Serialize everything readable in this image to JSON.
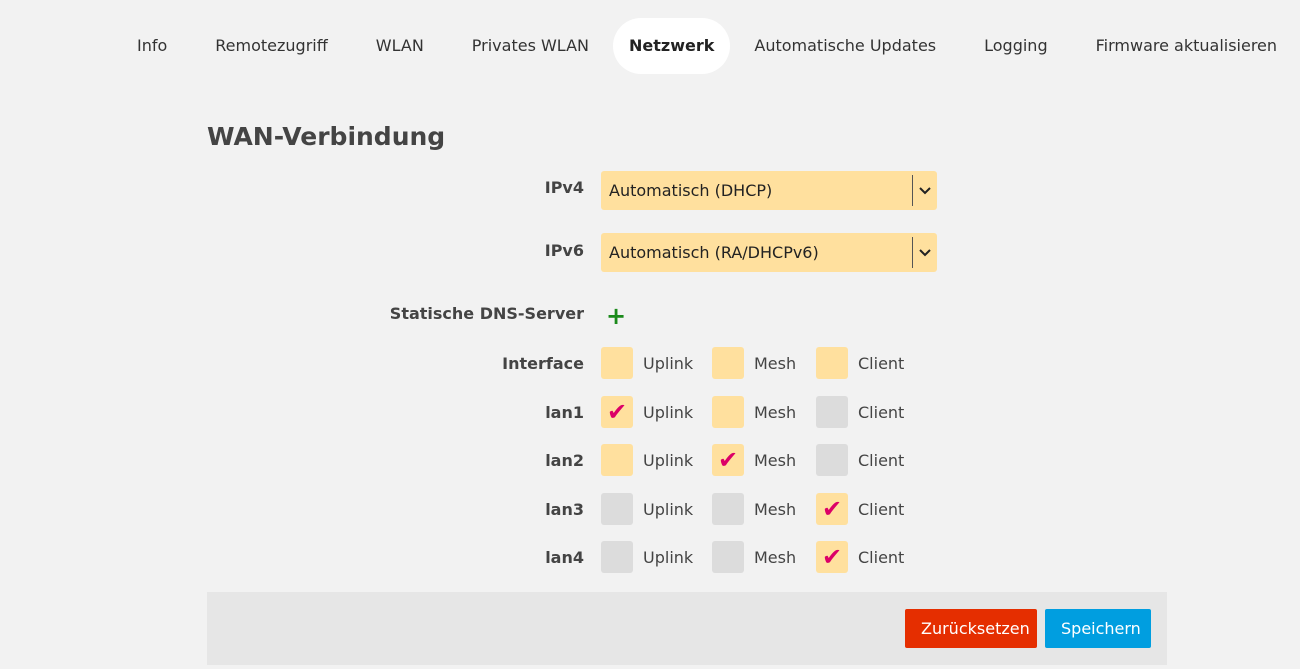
{
  "nav": {
    "tabs": [
      {
        "label": "Info"
      },
      {
        "label": "Remotezugriff"
      },
      {
        "label": "WLAN"
      },
      {
        "label": "Privates WLAN"
      },
      {
        "label": "Netzwerk",
        "active": true
      },
      {
        "label": "Automatische Updates"
      },
      {
        "label": "Logging"
      },
      {
        "label": "Firmware aktualisieren"
      }
    ]
  },
  "section": {
    "title": "WAN-Verbindung"
  },
  "ipv4": {
    "label": "IPv4",
    "value": "Automatisch (DHCP)"
  },
  "ipv6": {
    "label": "IPv6",
    "value": "Automatisch (RA/DHCPv6)"
  },
  "dns": {
    "label": "Statische DNS-Server",
    "add_icon": "+"
  },
  "interfaces": {
    "col_labels": [
      "Uplink",
      "Mesh",
      "Client"
    ],
    "check_glyph": "✔",
    "rows": [
      {
        "name": "Interface",
        "checks": [
          false,
          false,
          false
        ],
        "enabled": [
          true,
          true,
          true
        ]
      },
      {
        "name": "lan1",
        "checks": [
          true,
          false,
          false
        ],
        "enabled": [
          true,
          true,
          false
        ]
      },
      {
        "name": "lan2",
        "checks": [
          false,
          true,
          false
        ],
        "enabled": [
          true,
          true,
          false
        ]
      },
      {
        "name": "lan3",
        "checks": [
          false,
          false,
          true
        ],
        "enabled": [
          false,
          false,
          true
        ]
      },
      {
        "name": "lan4",
        "checks": [
          false,
          false,
          true
        ],
        "enabled": [
          false,
          false,
          true
        ]
      }
    ]
  },
  "buttons": {
    "reset": "Zurücksetzen",
    "save": "Speichern"
  },
  "colors": {
    "checkbox_on": "#ffe09e",
    "checkbox_off": "#dcdcdc",
    "check": "#dc0067",
    "reset": "#e52e00",
    "save": "#009ee0"
  }
}
